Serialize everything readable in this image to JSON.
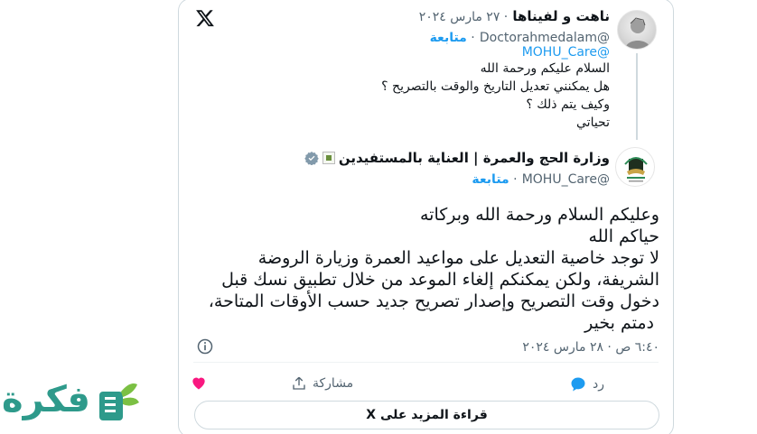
{
  "quoted": {
    "name": "ناهت و لفيناها",
    "date": "· ٢٧ مارس ٢٠٢٤",
    "handle": "@Doctorahmedalam",
    "follow": "متابعة",
    "mention": "@MOHU_Care",
    "lines": [
      "السلام عليكم ورحمة الله",
      "هل يمكنني تعديل التاريخ والوقت بالتصريح ؟",
      "وكيف يتم ذلك ؟",
      "تحياتي"
    ]
  },
  "main": {
    "name": "وزارة الحج والعمرة | العناية بالمستفيدين",
    "handle": "@MOHU_Care",
    "follow": "متابعة",
    "verified_icon": "verified-badge-icon",
    "lines": [
      "وعليكم السلام ورحمة الله وبركاته",
      "حياكم الله",
      "لا توجد خاصية التعديل على مواعيد العمرة وزيارة الروضة",
      "الشريفة، ولكن يمكنكم إلغاء الموعد من خلال تطبيق نسك قبل",
      "دخول وقت التصريح وإصدار تصريح جديد حسب الأوقات المتاحة،",
      "دمتم بخير"
    ],
    "timestamp": "٦:٤٠ ص · ٢٨ مارس ٢٠٢٤"
  },
  "actions": {
    "reply": "رد",
    "share": "مشاركة"
  },
  "more_button": "قراءة المزيد على X",
  "watermark": "فكرة",
  "colors": {
    "accent": "#1d9bf0",
    "heart": "#f91880",
    "border": "#cfd9de",
    "muted": "#536471",
    "logo_green": "#2e9a8b"
  }
}
